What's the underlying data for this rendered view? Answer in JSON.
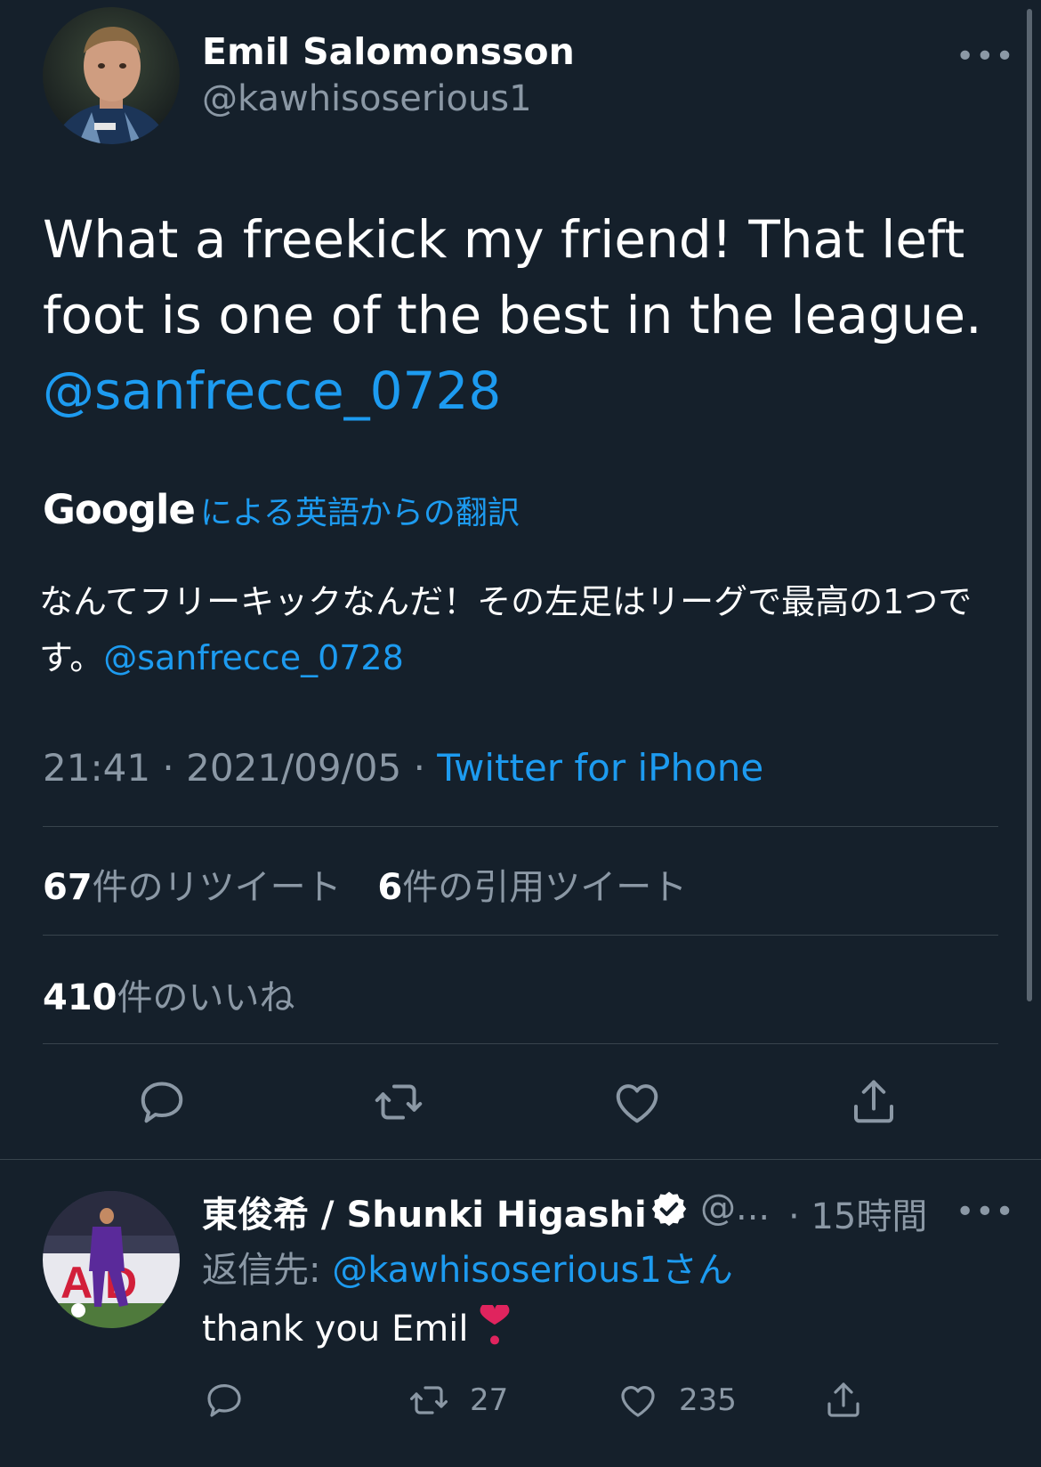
{
  "main_tweet": {
    "author_name": "Emil Salomonsson",
    "author_handle": "@kawhisoserious1",
    "text": "What a freekick my friend! That left foot is one of the best in the league. ",
    "mention": "@sanfrecce_0728",
    "translation": {
      "brand": "Google",
      "label": "による英語からの翻訳",
      "text": "なんてフリーキックなんだ！その左足はリーグで最高の1つです。",
      "mention": "@sanfrecce_0728"
    },
    "time": "21:41",
    "date": "2021/09/05",
    "source": "Twitter for iPhone",
    "retweets": {
      "count": "67",
      "label": "件のリツイート"
    },
    "quotes": {
      "count": "6",
      "label": "件の引用ツイート"
    },
    "likes": {
      "count": "410",
      "label": "件のいいね"
    }
  },
  "reply_tweet": {
    "author_name": "東俊希 / Shunki Higashi",
    "author_handle": "@...",
    "time_ago": "15時間",
    "reply_to_prefix": "返信先: ",
    "reply_to_mention": "@kawhisoserious1さん",
    "text": "thank you Emil",
    "retweet_count": "27",
    "like_count": "235"
  },
  "colors": {
    "background": "#15202b",
    "accent": "#1d9bf0",
    "secondary_text": "#8b98a5",
    "divider": "#38444d",
    "heart_emoji": "#e0245e"
  },
  "icons": [
    "more-icon",
    "reply-icon",
    "retweet-icon",
    "like-icon",
    "share-icon",
    "verified-icon",
    "heart-emoji-icon"
  ]
}
